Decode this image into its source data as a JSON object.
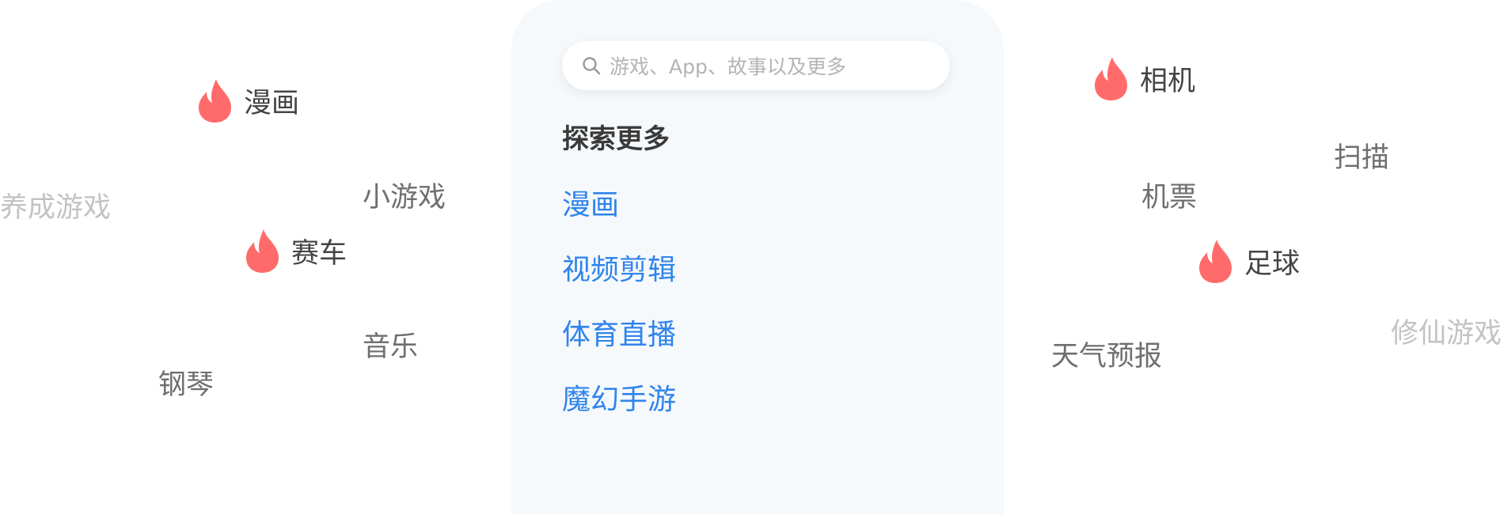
{
  "colors": {
    "accent": "#2f84ec",
    "flame": "#ff6b6b",
    "panel_bg": "#f6f9fc"
  },
  "panel": {
    "search": {
      "icon": "search-icon",
      "placeholder": "游戏、App、故事以及更多"
    },
    "title": "探索更多",
    "links": [
      "漫画",
      "视频剪辑",
      "体育直播",
      "魔幻手游"
    ]
  },
  "left_tags": {
    "comics": {
      "label": "漫画",
      "icon": "flame-icon",
      "hot": true
    },
    "raising_games": {
      "label": "养成游戏"
    },
    "mini_games": {
      "label": "小游戏"
    },
    "racing": {
      "label": "赛车",
      "icon": "flame-icon",
      "hot": true
    },
    "music": {
      "label": "音乐"
    },
    "piano": {
      "label": "钢琴"
    }
  },
  "right_tags": {
    "camera": {
      "label": "相机",
      "icon": "flame-icon",
      "hot": true
    },
    "scan": {
      "label": "扫描"
    },
    "flight_tickets": {
      "label": "机票"
    },
    "football": {
      "label": "足球",
      "icon": "flame-icon",
      "hot": true
    },
    "cultivation_games": {
      "label": "修仙游戏"
    },
    "weather": {
      "label": "天气预报"
    }
  }
}
